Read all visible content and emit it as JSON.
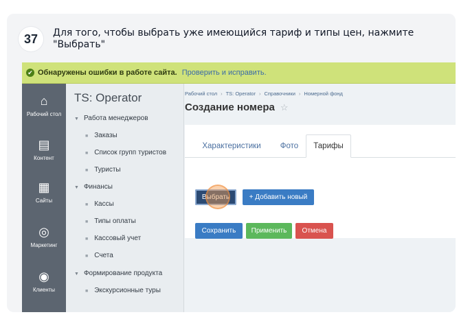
{
  "step": {
    "number": "37",
    "instruction": "Для того, чтобы выбрать уже имеющийся тариф и типы цен, нажмите \"Выбрать\""
  },
  "error_bar": {
    "message": "Обнаружены ошибки в работе сайта.",
    "link": "Проверить и исправить."
  },
  "iconbar": [
    {
      "icon": "home-icon",
      "glyph": "⌂",
      "label": "Рабочий стол"
    },
    {
      "icon": "document-icon",
      "glyph": "▤",
      "label": "Контент"
    },
    {
      "icon": "calendar-icon",
      "glyph": "▦",
      "label": "Сайты"
    },
    {
      "icon": "target-icon",
      "glyph": "◎",
      "label": "Маркетинг"
    },
    {
      "icon": "clients-icon",
      "glyph": "◉",
      "label": "Клиенты"
    }
  ],
  "menu": {
    "title": "TS: Operator",
    "items": [
      {
        "label": "Работа менеджеров",
        "type": "section"
      },
      {
        "label": "Заказы",
        "type": "item"
      },
      {
        "label": "Список групп туристов",
        "type": "item"
      },
      {
        "label": "Туристы",
        "type": "item"
      },
      {
        "label": "Финансы",
        "type": "section"
      },
      {
        "label": "Кассы",
        "type": "item"
      },
      {
        "label": "Типы оплаты",
        "type": "item"
      },
      {
        "label": "Кассовый учет",
        "type": "item"
      },
      {
        "label": "Счета",
        "type": "item"
      },
      {
        "label": "Формирование продукта",
        "type": "section"
      },
      {
        "label": "Экскурсионные туры",
        "type": "item"
      }
    ]
  },
  "breadcrumb": [
    "Рабочий стол",
    "TS: Operator",
    "Справочники",
    "Номерной фонд"
  ],
  "page_title": "Создание номера",
  "tabs": [
    {
      "label": "Характеристики",
      "active": false
    },
    {
      "label": "Фото",
      "active": false
    },
    {
      "label": "Тарифы",
      "active": true
    }
  ],
  "buttons": {
    "select": "Выбрать",
    "add_new": "+ Добавить новый",
    "save": "Сохранить",
    "apply": "Применить",
    "cancel": "Отмена"
  },
  "colors": {
    "error_bar": "#cfe27a",
    "primary": "#3a7cc4",
    "success": "#5cb85c",
    "danger": "#d9534f",
    "highlight": "#f59e50"
  }
}
